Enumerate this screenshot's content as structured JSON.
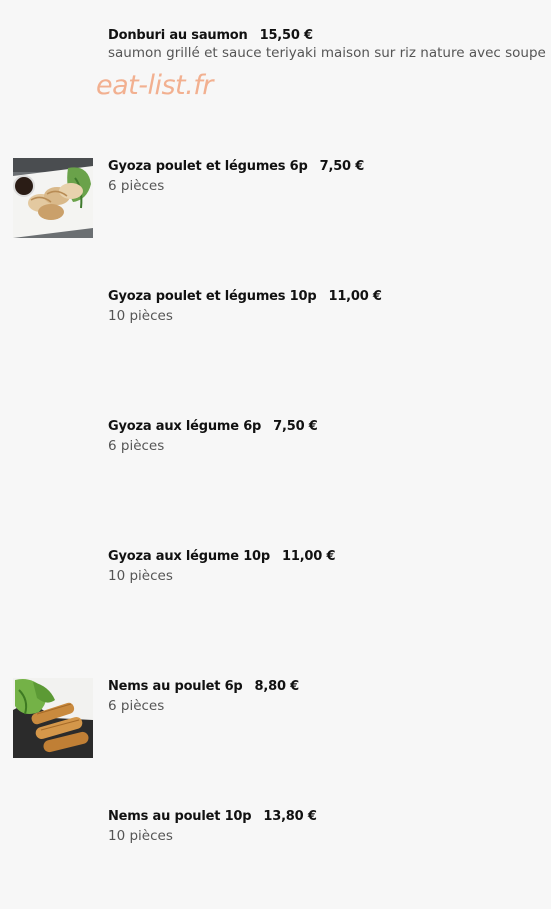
{
  "watermark": "eat-list.fr",
  "items": [
    {
      "name": "Donburi au saumon",
      "price": "15,50 €",
      "desc": "saumon grillé et sauce teriyaki maison sur riz nature avec soupe"
    },
    {
      "name": "Gyoza poulet et légumes 6p",
      "price": "7,50 €",
      "desc": "6 pièces",
      "image": "gyoza-photo"
    },
    {
      "name": "Gyoza poulet et légumes 10p",
      "price": "11,00 €",
      "desc": "10 pièces"
    },
    {
      "name": "Gyoza aux légume 6p",
      "price": "7,50 €",
      "desc": "6 pièces"
    },
    {
      "name": "Gyoza aux légume 10p",
      "price": "11,00 €",
      "desc": "10 pièces"
    },
    {
      "name": "Nems au poulet 6p",
      "price": "8,80 €",
      "desc": "6 pièces",
      "image": "nems-photo"
    },
    {
      "name": "Nems au poulet 10p",
      "price": "13,80 €",
      "desc": "10 pièces"
    }
  ]
}
